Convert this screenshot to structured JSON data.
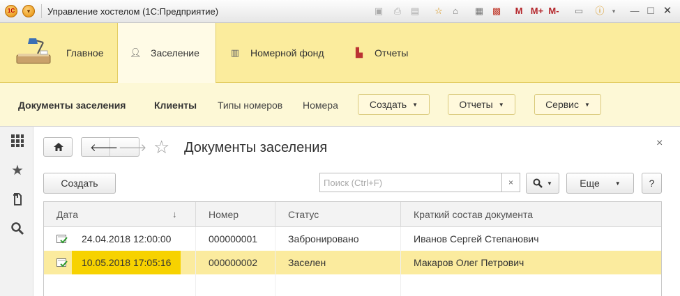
{
  "window": {
    "title": "Управление хостелом  (1С:Предприятие)",
    "toolbar_text_buttons": [
      "M",
      "M+",
      "M-"
    ]
  },
  "sections": [
    {
      "label": "Главное",
      "icon": "home-desk-lamp-icon"
    },
    {
      "label": "Заселение",
      "icon": "person-icon",
      "active": true
    },
    {
      "label": "Номерной фонд",
      "icon": "grid-icon"
    },
    {
      "label": "Отчеты",
      "icon": "bar-chart-icon"
    }
  ],
  "functions": {
    "links": [
      "Документы заселения",
      "Клиенты",
      "Типы номеров",
      "Номера"
    ],
    "menus": [
      "Создать",
      "Отчеты",
      "Сервис"
    ]
  },
  "form": {
    "title": "Документы заселения",
    "create_label": "Создать",
    "search_placeholder": "Поиск (Ctrl+F)",
    "search_clear": "×",
    "more_label": "Еще",
    "help_label": "?",
    "close_label": "×",
    "columns": [
      "Дата",
      "Номер",
      "Статус",
      "Краткий состав документа"
    ],
    "sort_indicator": "↓",
    "rows": [
      {
        "date": "24.04.2018 12:00:00",
        "number": "000000001",
        "status": "Забронировано",
        "summary": "Иванов Сергей Степанович",
        "selected": false
      },
      {
        "date": "10.05.2018 17:05:16",
        "number": "000000002",
        "status": "Заселен",
        "summary": "Макаров Олег Петрович",
        "selected": true
      }
    ]
  },
  "colors": {
    "section_panel": "#fbec9d",
    "function_panel": "#fdf8d6",
    "selected_row": "#fbeb9e",
    "selected_cell": "#f7d200"
  }
}
